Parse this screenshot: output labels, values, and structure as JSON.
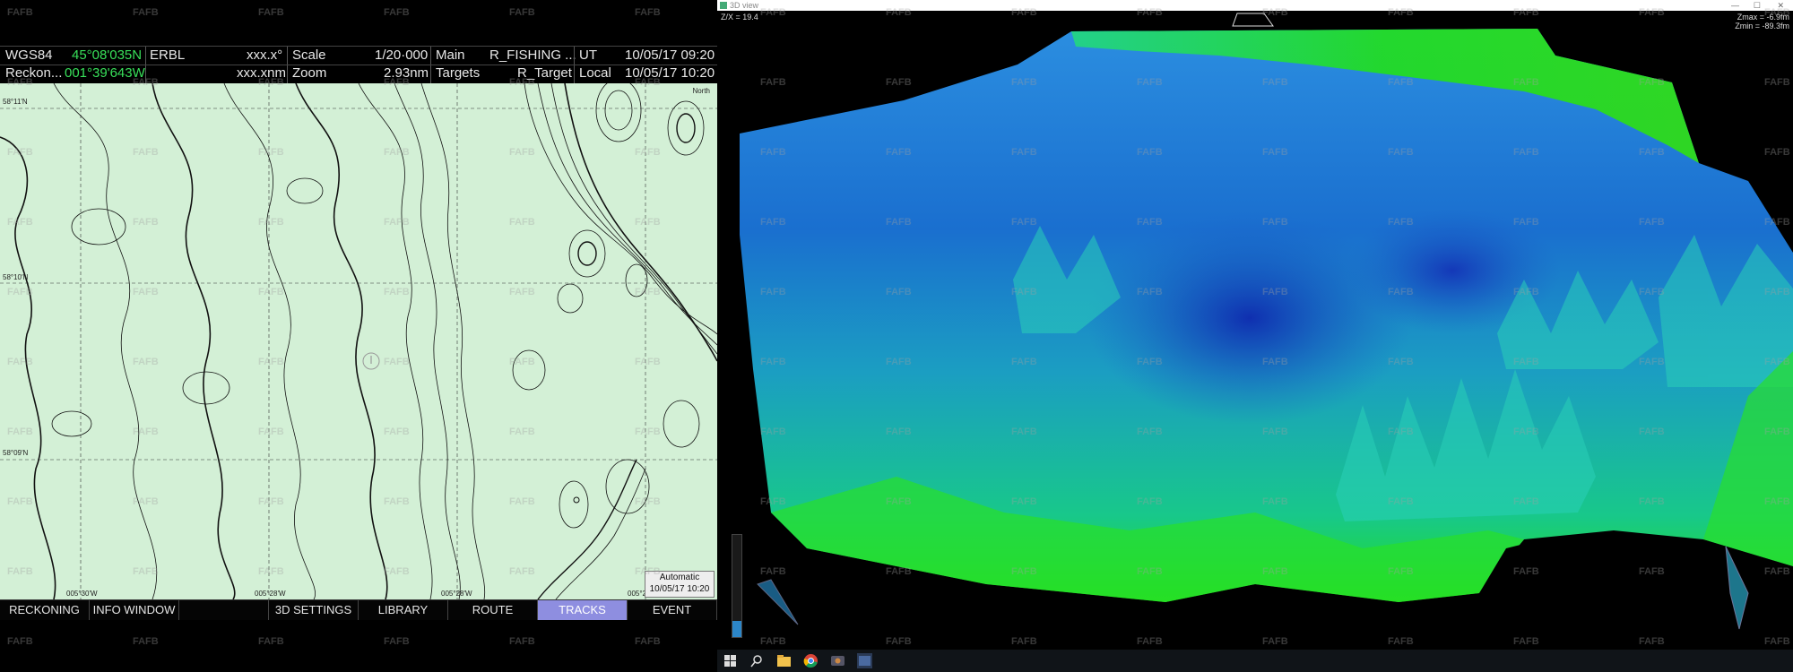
{
  "watermark": "FAFB",
  "info": {
    "datum": "WGS84",
    "lat": "45°08'035N",
    "erbl": "ERBL",
    "bearing": "xxx.x°",
    "scale_label": "Scale",
    "scale_value": "1/20·000",
    "main_label": "Main",
    "main_value": "R_FISHING ...",
    "ut_label": "UT",
    "ut_value": "10/05/17 09:20",
    "mode": "Reckon...",
    "lon": "001°39'643W",
    "distance": "xxx.xnm",
    "zoom_label": "Zoom",
    "zoom_value": "2.93nm",
    "targets_label": "Targets",
    "targets_value": "R_Target",
    "local_label": "Local",
    "local_value": "10/05/17 10:20"
  },
  "chart": {
    "north_label": "North",
    "lat_ticks": [
      "58°11'N",
      "58°10'N",
      "58°09'N"
    ],
    "lon_ticks": [
      "005°30'W",
      "005°28'W",
      "005°28'W",
      "005°2"
    ],
    "auto_status": "Automatic",
    "auto_time": "10/05/17 10:20",
    "bg_color": "#d3f0d6"
  },
  "tabs": [
    {
      "label": "RECKONING",
      "active": false
    },
    {
      "label": "INFO WINDOW",
      "active": false
    },
    {
      "label": "",
      "active": false
    },
    {
      "label": "3D SETTINGS",
      "active": false
    },
    {
      "label": "LIBRARY",
      "active": false
    },
    {
      "label": "ROUTE",
      "active": false
    },
    {
      "label": "TRACKS",
      "active": true
    },
    {
      "label": "EVENT",
      "active": false
    }
  ],
  "view3d": {
    "title": "3D view",
    "zx": "Z/X = 19.4",
    "zmax": "Zmax = -6.9fm",
    "zmin": "Zmin = -89.3fm",
    "depth_gauge_level": 0.16,
    "colors": {
      "shallow": "#22e01a",
      "mid": "#19c8b8",
      "deep": "#1a3fc0"
    }
  },
  "taskbar": {
    "icons": [
      "windows-start-icon",
      "search-icon",
      "file-explorer-icon",
      "chrome-icon",
      "app-icon",
      "chart-app-icon"
    ]
  }
}
